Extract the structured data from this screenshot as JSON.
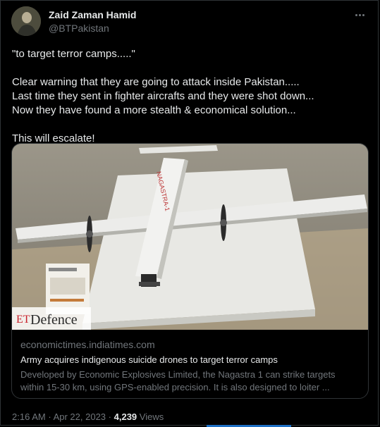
{
  "author": {
    "name": "Zaid Zaman Hamid",
    "handle": "@BTPakistan"
  },
  "tweet": {
    "lines": [
      "\"to target terror camps.....\"",
      "Clear warning that they are going to attack inside Pakistan.....",
      "Last time they sent in fighter aircrafts and they were shot down...",
      "Now they have found a more stealth & economical solution...",
      "This will escalate!"
    ]
  },
  "card": {
    "watermark_prefix": "ET",
    "watermark_word": "Defence",
    "aircraft_label": "NAGASTRA-1",
    "domain": "economictimes.indiatimes.com",
    "headline": "Army acquires indigenous suicide drones to target terror camps",
    "description": "Developed by Economic Explosives Limited, the Nagastra 1 can strike targets within 15-30 km, using GPS-enabled precision. It is also designed to loiter ..."
  },
  "footer": {
    "time": "2:16 AM",
    "separator": "·",
    "date": "Apr 22, 2023",
    "views_count": "4,239",
    "views_label": "Views"
  },
  "colors": {
    "background": "#000000",
    "text_primary": "#e7e9ea",
    "text_secondary": "#71767b",
    "border": "#2f3336"
  },
  "icons": {
    "more": "more-options-icon"
  }
}
